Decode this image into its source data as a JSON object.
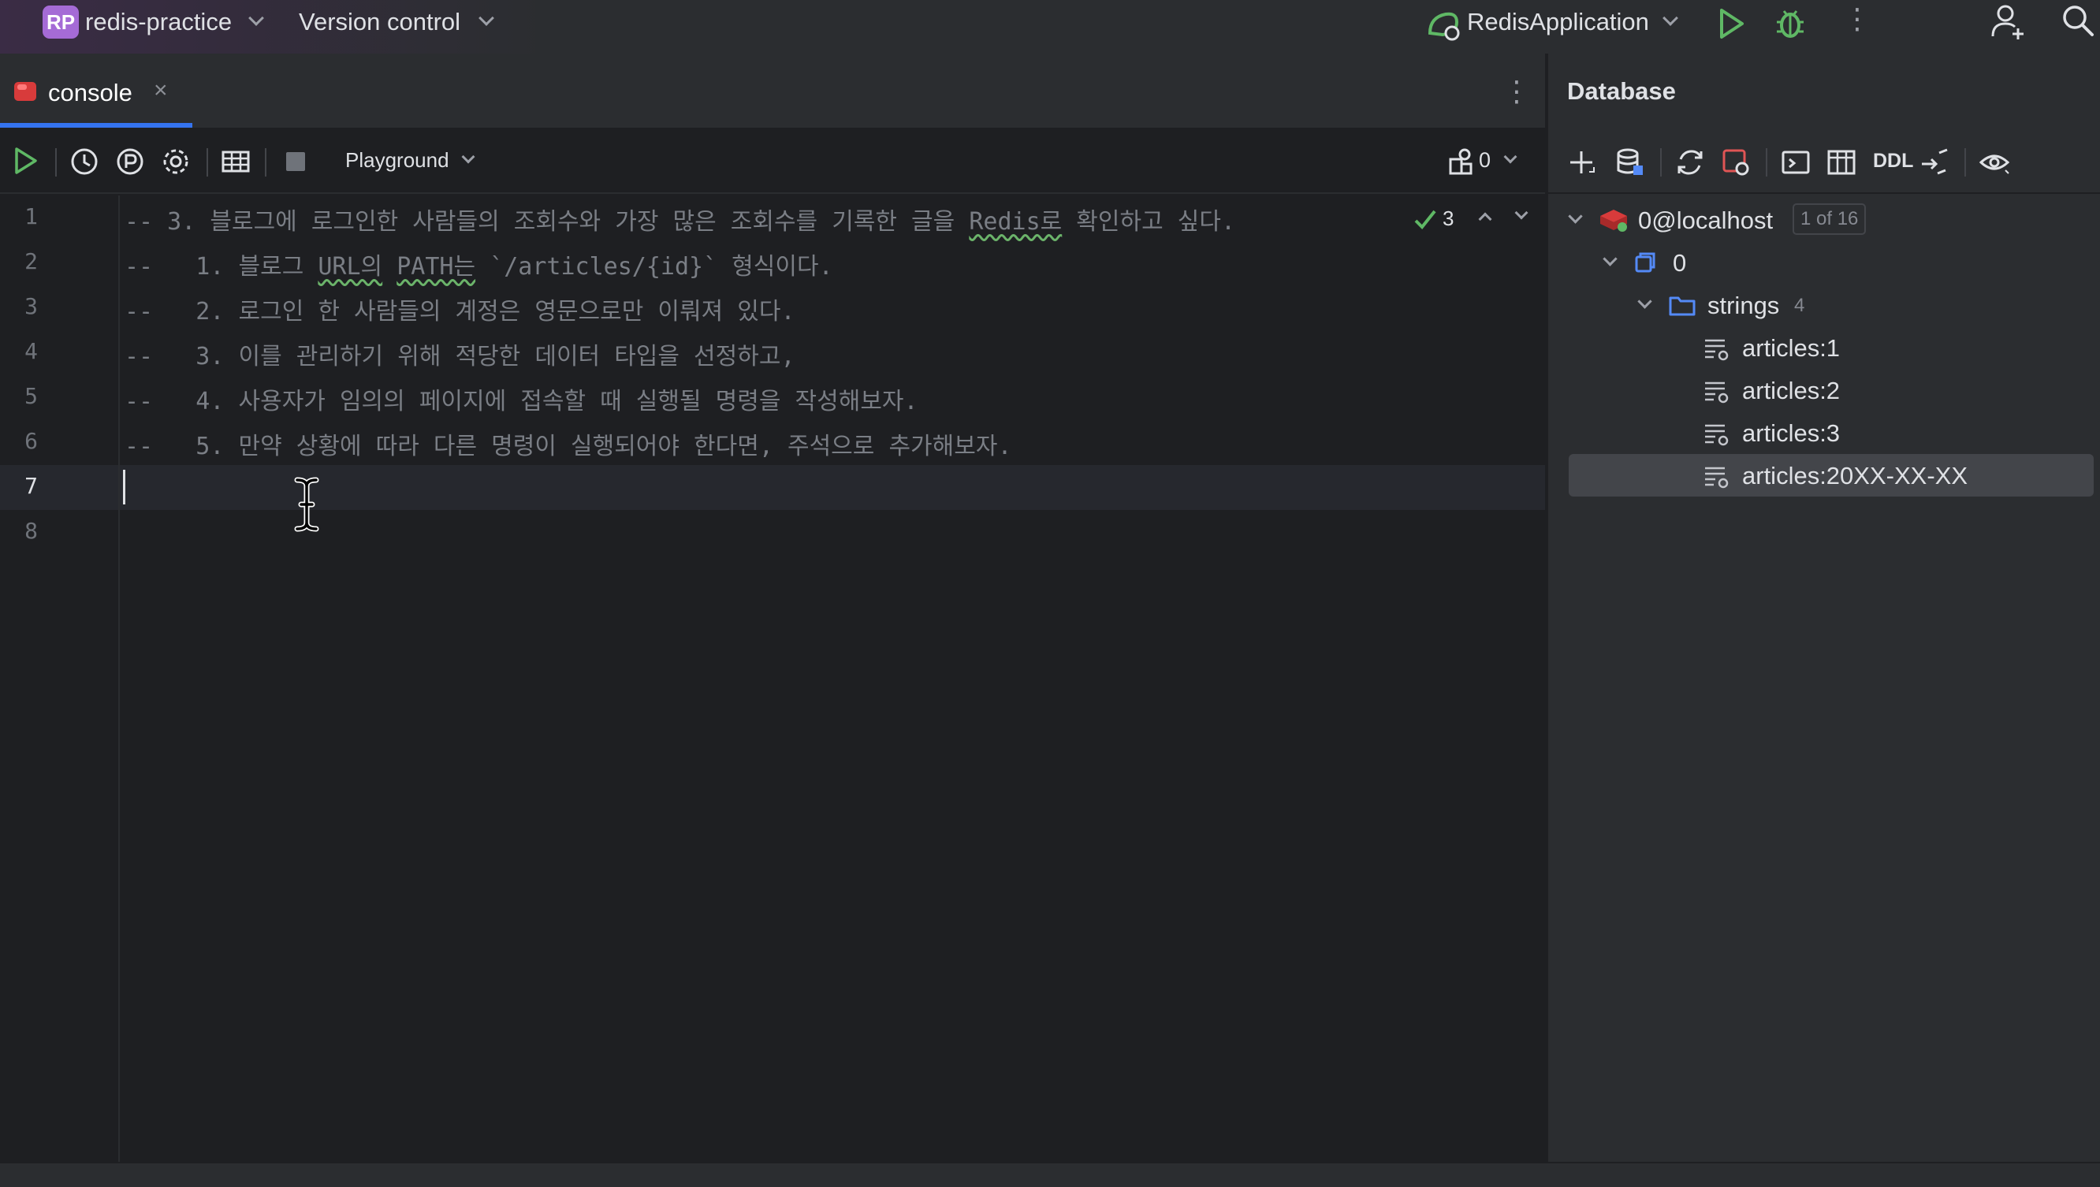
{
  "titlebar": {
    "project_badge": "RP",
    "project_name": "redis-practice",
    "version_control": "Version control",
    "run_config": "RedisApplication"
  },
  "editor_tab": {
    "label": "console",
    "close": "×"
  },
  "editor_toolbar": {
    "playground": "Playground",
    "session_count": "0"
  },
  "editor": {
    "inspection_count": "3",
    "line_numbers": [
      "1",
      "2",
      "3",
      "4",
      "5",
      "6",
      "7",
      "8"
    ],
    "current_line": 7,
    "lines": [
      {
        "prefix": "-- 3. 블로그에 로그인한 사람들의 조회수와 가장 많은 조회수를 기록한 글을 ",
        "squiggle": "Redis로",
        "suffix": " 확인하고 싶다."
      },
      {
        "prefix": "--   1. 블로그 ",
        "squiggle": "URL의",
        "mid": " ",
        "squiggle2": "PATH는",
        "suffix": " `/articles/{id}` 형식이다."
      },
      {
        "text": "--   2. 로그인 한 사람들의 계정은 영문으로만 이뤄져 있다."
      },
      {
        "text": "--   3. 이를 관리하기 위해 적당한 데이터 타입을 선정하고,"
      },
      {
        "text": "--   4. 사용자가 임의의 페이지에 접속할 때 실행될 명령을 작성해보자."
      },
      {
        "text": "--   5. 만약 상황에 따라 다른 명령이 실행되어야 한다면, 주석으로 추가해보자."
      }
    ]
  },
  "database": {
    "title": "Database",
    "toolbar_ddl": "DDL",
    "tree": {
      "connection": "0@localhost",
      "connection_pill": "1 of 16",
      "db": "0",
      "folder": "strings",
      "folder_count": "4",
      "keys": [
        "articles:1",
        "articles:2",
        "articles:3",
        "articles:20XX-XX-XX"
      ],
      "selected_key_index": 3
    }
  },
  "colors": {
    "accent": "#3574f0",
    "run_green": "#5fb865",
    "redis_red": "#d83b3b",
    "folder_blue": "#548af7",
    "comment_gray": "#7a7e85"
  }
}
